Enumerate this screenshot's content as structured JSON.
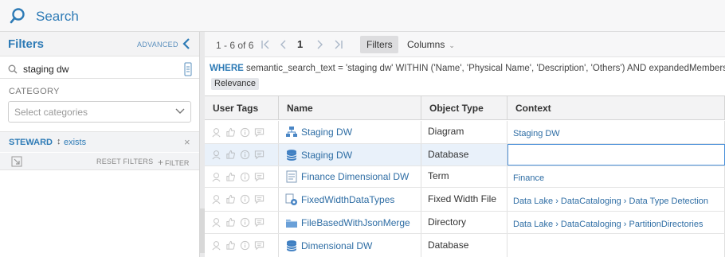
{
  "topbar": {
    "search_label": "Search"
  },
  "filters_panel": {
    "title": "Filters",
    "advanced_label": "ADVANCED",
    "search_value": "staging dw",
    "category_label": "CATEGORY",
    "category_placeholder": "Select categories",
    "steward": {
      "name": "STEWARD",
      "sort_glyph": "↕",
      "value": "exists",
      "remove": "×"
    },
    "reset_label": "RESET FILTERS",
    "add_filter_label": "FILTER",
    "add_filter_plus": "+"
  },
  "toolbar": {
    "range": "1 - 6 of 6",
    "page": "1",
    "filters_button": "Filters",
    "columns_button": "Columns",
    "columns_chevron": "⌄"
  },
  "query": {
    "keyword": "WHERE",
    "text": "semantic_search_text = 'staging dw' WITHIN ('Name', 'Physical Name', 'Description', 'Others') AND expandedMembersOfRo",
    "relevance_tag": "Relevance"
  },
  "grid": {
    "columns": [
      "User Tags",
      "Name",
      "Object Type",
      "Context"
    ],
    "rows": [
      {
        "name": "Staging DW",
        "icon": "diagram-icon",
        "type": "Diagram",
        "context": "Staging DW",
        "selected": false
      },
      {
        "name": "Staging DW",
        "icon": "database-icon",
        "type": "Database",
        "context": "",
        "selected": true
      },
      {
        "name": "Finance Dimensional DW",
        "icon": "term-icon",
        "type": "Term",
        "context": "Finance",
        "selected": false
      },
      {
        "name": "FixedWidthDataTypes",
        "icon": "fixed-width-file-icon",
        "type": "Fixed Width File",
        "context": "Data Lake › DataCataloging › Data Type Detection",
        "selected": false
      },
      {
        "name": "FileBasedWithJsonMerge",
        "icon": "folder-icon",
        "type": "Directory",
        "context": "Data Lake › DataCataloging › PartitionDirectories",
        "selected": false
      },
      {
        "name": "Dimensional DW",
        "icon": "database-icon",
        "type": "Database",
        "context": "",
        "selected": false
      }
    ]
  },
  "colors": {
    "accent": "#2e7bb6",
    "link": "#2e6da4",
    "selected_row": "#e9f1fa"
  }
}
